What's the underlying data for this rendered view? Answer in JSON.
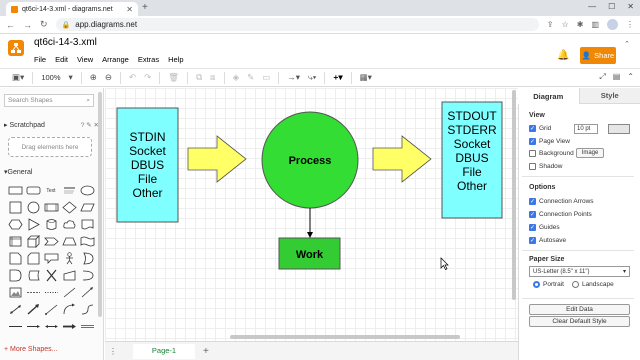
{
  "browser": {
    "tab_title": "qt6ci-14-3.xml - diagrams.net",
    "url": "app.diagrams.net"
  },
  "app": {
    "filename": "qt6ci-14-3.xml",
    "menu": [
      "File",
      "Edit",
      "View",
      "Arrange",
      "Extras",
      "Help"
    ],
    "share_label": "Share",
    "brand_color": "#f08705"
  },
  "toolbar": {
    "zoom": "100%"
  },
  "sidebar": {
    "search_placeholder": "Search Shapes",
    "scratchpad_label": "Scratchpad",
    "scratchpad_drop": "Drag elements here",
    "general_label": "General",
    "shape_text_label": "Text",
    "more_shapes": "+ More Shapes..."
  },
  "diagram": {
    "left_box_lines": [
      "STDIN",
      "Socket",
      "DBUS",
      "File",
      "Other"
    ],
    "right_box_lines": [
      "STDOUT",
      "STDERR",
      "Socket",
      "DBUS",
      "File",
      "Other"
    ],
    "process_label": "Process",
    "work_label": "Work",
    "colors": {
      "box_fill": "#7fffff",
      "circle_fill": "#33dd33",
      "work_fill": "#33cc33",
      "arrow_fill": "#ffff66"
    }
  },
  "pages": {
    "current": "Page-1"
  },
  "format_panel": {
    "tabs": [
      "Diagram",
      "Style"
    ],
    "view_header": "View",
    "grid_label": "Grid",
    "grid_size": "10 pt",
    "page_view_label": "Page View",
    "background_label": "Background",
    "image_button": "Image",
    "shadow_label": "Shadow",
    "options_header": "Options",
    "connection_arrows": "Connection Arrows",
    "connection_points": "Connection Points",
    "guides": "Guides",
    "autosave": "Autosave",
    "paper_header": "Paper Size",
    "paper_size": "US-Letter (8.5\" x 11\")",
    "portrait": "Portrait",
    "landscape": "Landscape",
    "edit_data": "Edit Data",
    "clear_default_style": "Clear Default Style"
  }
}
